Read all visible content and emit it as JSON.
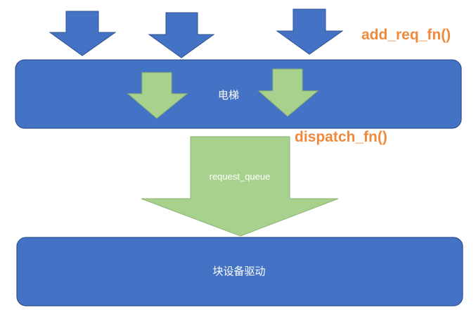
{
  "elevator": {
    "label": "电梯"
  },
  "queue": {
    "label": "request_queue"
  },
  "block_driver": {
    "label": "块设备驱动"
  },
  "functions": {
    "add_req": "add_req_fn()",
    "dispatch": "dispatch_fn()"
  },
  "colors": {
    "box_fill": "#4472c4",
    "box_stroke": "#2f528f",
    "arrow_blue": "#4472c4",
    "arrow_green": "#a9d18e",
    "arrow_green_stroke": "#8bb36f",
    "fn_text": "#ef8a3d",
    "label_text": "#ffffff"
  }
}
